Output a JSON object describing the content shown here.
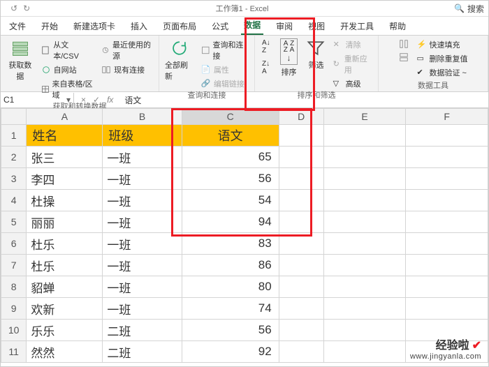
{
  "titlebar": {
    "win_title": "工作簿1 - Excel",
    "search_ph": "搜索"
  },
  "tabs": {
    "file": "文件",
    "home": "开始",
    "newtab": "新建选项卡",
    "insert": "插入",
    "layout": "页面布局",
    "formula": "公式",
    "data": "数据",
    "review": "审阅",
    "view": "视图",
    "dev": "开发工具",
    "help": "帮助"
  },
  "ribbon": {
    "getdata": "获取数\n据",
    "fromcsv": "从文本/CSV",
    "fromweb": "自网站",
    "fromtable": "来自表格/区域",
    "recent": "最近使用的源",
    "existing": "现有连接",
    "group1": "获取和转换数据",
    "refresh": "全部刷新",
    "queries": "查询和连接",
    "properties": "属性",
    "links": "编辑链接",
    "group2": "查询和连接",
    "sort": "排序",
    "filter": "筛选",
    "clear": "清除",
    "reapply": "重新应用",
    "advanced": "高级",
    "group3": "排序和筛选",
    "flash": "快速填充",
    "dedup": "删除重复值",
    "datav": "数据验证 ~",
    "group4": "数据工具"
  },
  "namebox": "C1",
  "formula_value": "语文",
  "cols": {
    "A": "A",
    "B": "B",
    "C": "C",
    "D": "D",
    "E": "E",
    "F": "F"
  },
  "header": {
    "A": "姓名",
    "B": "班级",
    "C": "语文"
  },
  "rows": [
    {
      "n": "2",
      "A": "张三",
      "B": "一班",
      "C": "65"
    },
    {
      "n": "3",
      "A": "李四",
      "B": "一班",
      "C": "56"
    },
    {
      "n": "4",
      "A": "杜操",
      "B": "一班",
      "C": "54"
    },
    {
      "n": "5",
      "A": "丽丽",
      "B": "一班",
      "C": "94"
    },
    {
      "n": "6",
      "A": "杜乐",
      "B": "一班",
      "C": "83"
    },
    {
      "n": "7",
      "A": "杜乐",
      "B": "一班",
      "C": "86"
    },
    {
      "n": "8",
      "A": "貂蝉",
      "B": "一班",
      "C": "80"
    },
    {
      "n": "9",
      "A": "欢新",
      "B": "一班",
      "C": "74"
    },
    {
      "n": "10",
      "A": "乐乐",
      "B": "二班",
      "C": "56"
    },
    {
      "n": "11",
      "A": "然然",
      "B": "二班",
      "C": "92"
    }
  ],
  "watermark": {
    "line1": "经验啦",
    "line2": "www.jingyanla.com"
  }
}
